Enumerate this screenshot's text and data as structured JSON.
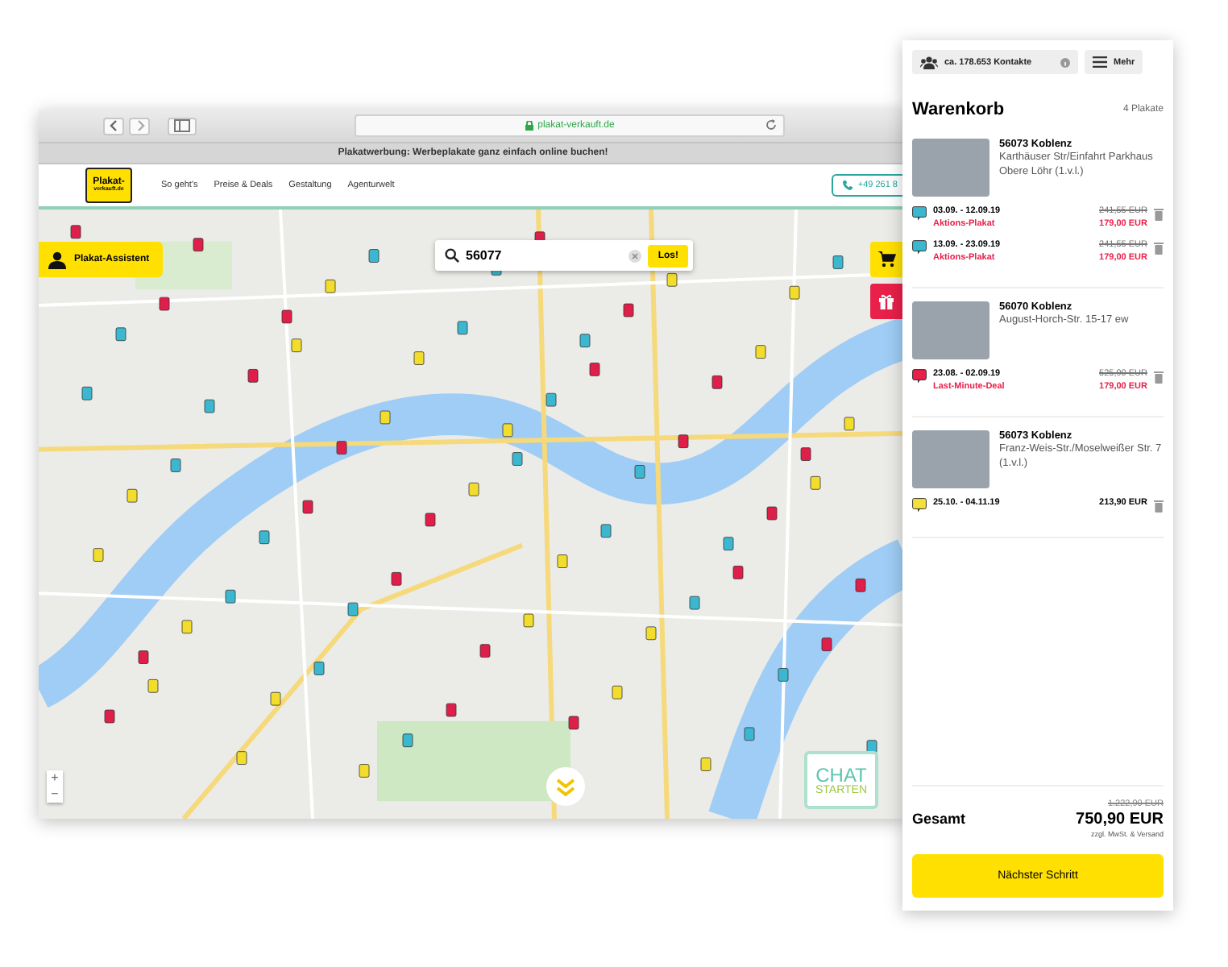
{
  "browser": {
    "url": "plakat-verkauft.de",
    "banner": "Plakatwerbung: Werbeplakate ganz einfach online buchen!",
    "header": {
      "logo_line1": "Plakat-",
      "logo_line2": "verkauft.de",
      "links": [
        "So geht's",
        "Preise & Deals",
        "Gestaltung",
        "Agenturwelt"
      ],
      "phone": "+49 261 8"
    },
    "map": {
      "assistant_button": "Plakat-Assistent",
      "search": {
        "value": "56077",
        "button": "Los!"
      },
      "zoom_in": "+",
      "zoom_out": "−",
      "chat_line1": "CHAT",
      "chat_line2": "STARTEN"
    }
  },
  "cart": {
    "contacts": "ca. 178.653 Kontakte",
    "more": "Mehr",
    "title": "Warenkorb",
    "count": "4 Plakate",
    "items": [
      {
        "title": "56073 Koblenz",
        "address": "Karthäuser Str/Einfahrt Parkhaus Obere Löhr (1.v.l.)",
        "bookings": [
          {
            "dates": "03.09. - 12.09.19",
            "old_price": "241,55 EUR",
            "price": "179,00 EUR",
            "deal": "Aktions-Plakat",
            "color": "#3bb8d0"
          },
          {
            "dates": "13.09. - 23.09.19",
            "old_price": "241,55 EUR",
            "price": "179,00 EUR",
            "deal": "Aktions-Plakat",
            "color": "#3bb8d0"
          }
        ]
      },
      {
        "title": "56070 Koblenz",
        "address": "August-Horch-Str. 15-17 ew",
        "bookings": [
          {
            "dates": "23.08. - 02.09.19",
            "old_price": "525,90 EUR",
            "price": "179,00 EUR",
            "deal": "Last-Minute-Deal",
            "color": "#e8204a"
          }
        ]
      },
      {
        "title": "56073 Koblenz",
        "address": "Franz-Weis-Str./Moselweißer Str. 7 (1.v.l.)",
        "bookings": [
          {
            "dates": "25.10. - 04.11.19",
            "price": "213,90 EUR",
            "color": "#f5e03a"
          }
        ]
      }
    ],
    "total_label": "Gesamt",
    "old_total": "1.222,90 EUR",
    "total": "750,90 EUR",
    "tax_note": "zzgl. MwSt. & Versand",
    "next_button": "Nächster Schritt"
  }
}
